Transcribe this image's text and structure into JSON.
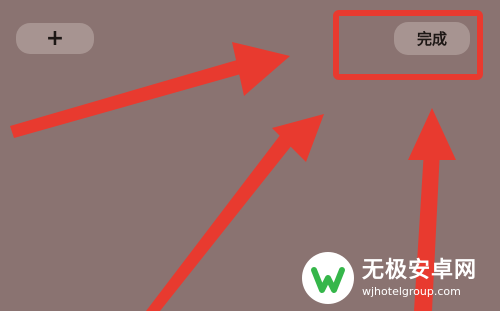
{
  "toolbar": {
    "add_label": "+",
    "done_label": "完成"
  },
  "annotation": {
    "color": "#e83a2f"
  },
  "watermark": {
    "title": "无极安卓网",
    "url": "wjhotelgroup.com",
    "logo_color": "#35b64a"
  },
  "colors": {
    "background": "#8a7371",
    "button_bg": "#a79491"
  }
}
